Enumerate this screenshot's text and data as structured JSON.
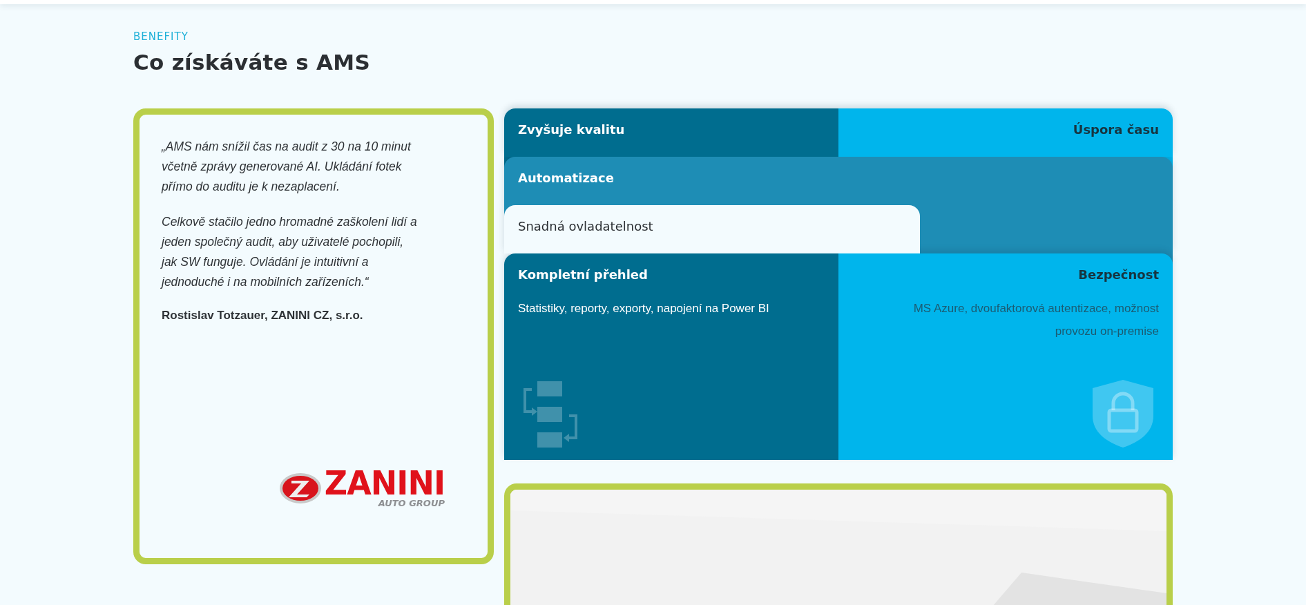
{
  "section": {
    "eyebrow": "BENEFITY",
    "title": "Co získáváte s AMS"
  },
  "testimonial": {
    "paragraphs": [
      "„AMS nám snížil čas na audit z 30 na 10 minut včetně zprávy generované AI. Ukládání fotek přímo do auditu je k nezaplacení.",
      "Celkově stačilo jedno hromadné zaškolení lidí a jeden společný audit, aby uživatelé pochopili, jak SW funguje. Ovládání je intuitivní a jednoduché i na mobilních zařízeních.“"
    ],
    "author": "Rostislav Totzauer, ZANINI CZ, s.r.o.",
    "logo": {
      "name": "ZANINI",
      "tagline": "AUTO GROUP"
    }
  },
  "benefits": [
    {
      "kind": "split",
      "items": [
        {
          "kind": "dark",
          "title": "Zvyšuje kvalitu"
        },
        {
          "kind": "bright",
          "title": "Úspora času"
        }
      ]
    },
    {
      "kind": "full",
      "items": [
        {
          "kind": "medium",
          "title": "Automatizace"
        }
      ]
    },
    {
      "kind": "tab",
      "items": [
        {
          "kind": "light",
          "title": "Snadná ovladatelnost"
        }
      ]
    },
    {
      "kind": "open",
      "items": [
        {
          "kind": "dark",
          "title": "Kompletní přehled",
          "text": "Statistiky, reporty, exporty, napojení na Power BI"
        },
        {
          "kind": "bright",
          "title": "Bezpečnost",
          "text": "MS Azure, dvoufaktorová autentizace, možnost provozu on-premise"
        }
      ]
    }
  ]
}
